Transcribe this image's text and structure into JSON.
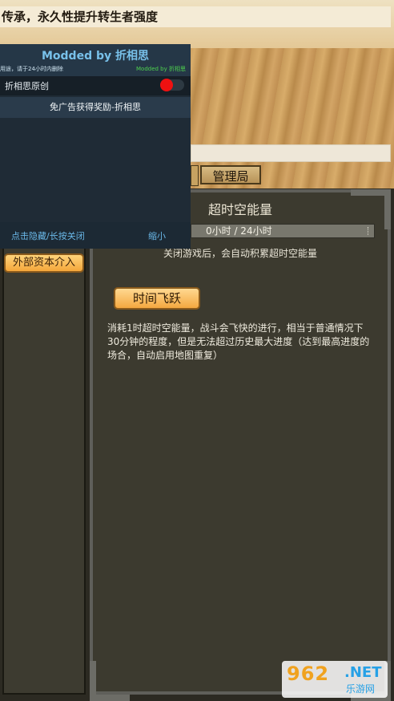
{
  "banner": {
    "text": "传承，永久性提升转生者强度"
  },
  "tabs": {
    "management": "管理局"
  },
  "left": {
    "button_label": "外部资本介入"
  },
  "panel": {
    "title": "超时空能量",
    "timebar_text": "0小时 / 24小时",
    "timebar_progress_percent": 0,
    "hint": "关闭游戏后，会自动积累超时空能量",
    "jump_button": "时间飞跃",
    "description": "消耗1时超时空能量，战斗会飞快的进行，相当于普通情况下30分钟的程度，但是无法超过历史最大进度（达到最高进度的场合，自动启用地图重复）"
  },
  "mod_menu": {
    "title": "Modded by 折相思",
    "subtitle_left": "用途，请于24小时内删除",
    "subtitle_right": "Modded by 折相思",
    "toggle_label": "折相思原创",
    "toggle_state": "on",
    "toggle_color": "#ef1111",
    "reward_button": "免广告获得奖励-折相思",
    "footer_left": "点击隐藏/长按关闭",
    "footer_right": "缩小"
  },
  "watermark": {
    "number": "962",
    "suffix": ".NET",
    "site": "乐游网"
  }
}
